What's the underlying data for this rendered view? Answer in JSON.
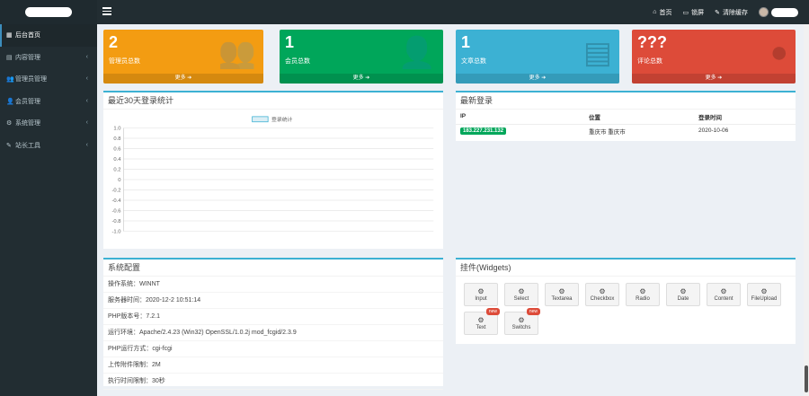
{
  "header": {
    "nav": [
      {
        "icon": "home-icon",
        "glyph": "⌂",
        "label": "首页"
      },
      {
        "icon": "monitor-icon",
        "glyph": "▭",
        "label": "锁屏"
      },
      {
        "icon": "brush-icon",
        "glyph": "✎",
        "label": "清除缓存"
      }
    ]
  },
  "sidebar": {
    "items": [
      {
        "icon": "dashboard-icon",
        "glyph": "▦",
        "label": "后台首页",
        "active": true
      },
      {
        "icon": "grid-icon",
        "glyph": "▤",
        "label": "内容管理"
      },
      {
        "icon": "users-icon",
        "glyph": "👥",
        "label": "管理员管理"
      },
      {
        "icon": "user-group-icon",
        "glyph": "👤",
        "label": "会员管理"
      },
      {
        "icon": "gear-icon",
        "glyph": "⚙",
        "label": "系统管理"
      },
      {
        "icon": "wrench-icon",
        "glyph": "✎",
        "label": "站长工具"
      }
    ]
  },
  "cards": [
    {
      "value": "2",
      "label": "管理员总数",
      "more": "更多 ➔",
      "color": "#f39c12",
      "icon": "users-icon"
    },
    {
      "value": "1",
      "label": "会员总数",
      "more": "更多 ➔",
      "color": "#00a65a",
      "icon": "user-add-icon"
    },
    {
      "value": "1",
      "label": "文章总数",
      "more": "更多 ➔",
      "color": "#3cb1d3",
      "icon": "document-icon"
    },
    {
      "value": "???",
      "label": "评论总数",
      "more": "更多 ➔",
      "color": "#dd4b39",
      "icon": "comment-icon"
    }
  ],
  "login_chart": {
    "title": "最近30天登录统计"
  },
  "chart_data": {
    "type": "line",
    "title": "最近30天登录统计",
    "series": [
      {
        "name": "登录统计",
        "values": []
      }
    ],
    "ylim": [
      -1.0,
      1.0
    ],
    "yticks": [
      "1.0",
      "0.8",
      "0.6",
      "0.4",
      "0.2",
      "0",
      "-0.2",
      "-0.4",
      "-0.6",
      "-0.8",
      "-1.0"
    ],
    "grid": true,
    "legend": "top-center"
  },
  "latest_login": {
    "title": "最新登录",
    "headers": [
      "IP",
      "位置",
      "登录时间"
    ],
    "rows": [
      {
        "ip": "183.227.231.132",
        "location": "重庆市 重庆市",
        "time": "2020-10-06"
      }
    ]
  },
  "system": {
    "title": "系统配置",
    "rows": [
      "操作系统：WINNT",
      "服务器时间：2020-12-2 10:51:14",
      "PHP版本号：7.2.1",
      "运行环境：Apache/2.4.23 (Win32) OpenSSL/1.0.2j mod_fcgid/2.3.9",
      "PHP运行方式：cgi-fcgi",
      "上传附件限制：2M",
      "执行时间限制：30秒"
    ]
  },
  "widgets": {
    "title": "挂件(Widgets)",
    "new_label": "new",
    "items": [
      "Input",
      "Select",
      "Textarea",
      "Checkbox",
      "Radio",
      "Date",
      "Content",
      "FileUpload",
      "Text",
      "Switchs"
    ]
  }
}
